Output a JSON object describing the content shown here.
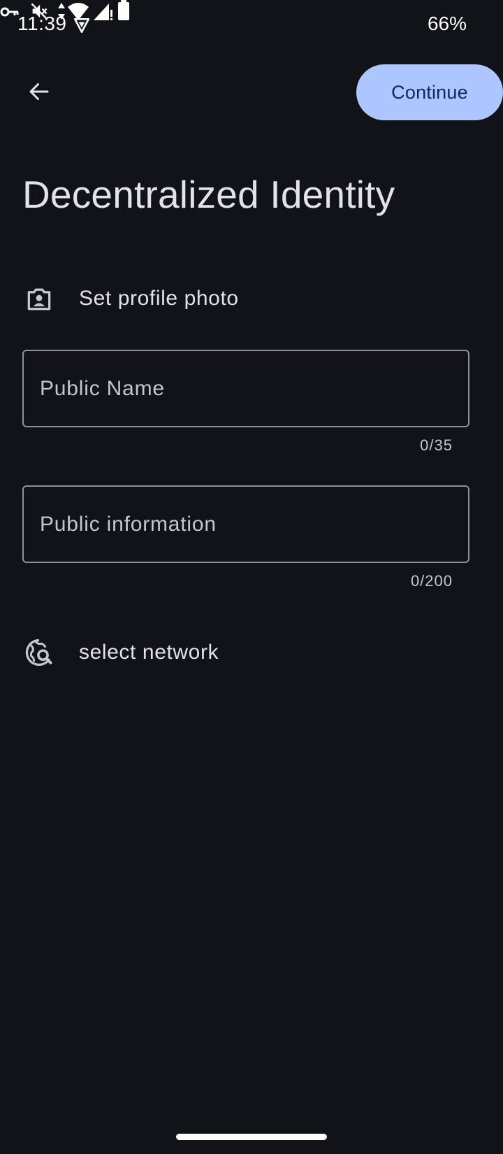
{
  "status_bar": {
    "time": "11:39",
    "battery_percent": "66%",
    "icons": [
      "vpn-shield-icon",
      "vpn-key-icon",
      "mute-icon",
      "wifi-data-icon",
      "signal-icon",
      "battery-icon"
    ]
  },
  "app_bar": {
    "back_icon": "arrow-back-icon",
    "continue_label": "Continue",
    "continue_color": "#adc6ff"
  },
  "title": "Decentralized Identity",
  "profile_photo": {
    "icon": "account-box-icon",
    "label": "Set profile photo"
  },
  "fields": {
    "public_name": {
      "placeholder": "Public Name",
      "value": "",
      "counter": "0/35"
    },
    "public_info": {
      "placeholder": "Public information",
      "value": "",
      "counter": "0/200"
    }
  },
  "network": {
    "icon": "travel-explore-icon",
    "label": "select network"
  },
  "colors": {
    "background": "#121318",
    "accent": "#adc6ff",
    "on_accent": "#0a2a63",
    "outline": "#8f9099"
  }
}
